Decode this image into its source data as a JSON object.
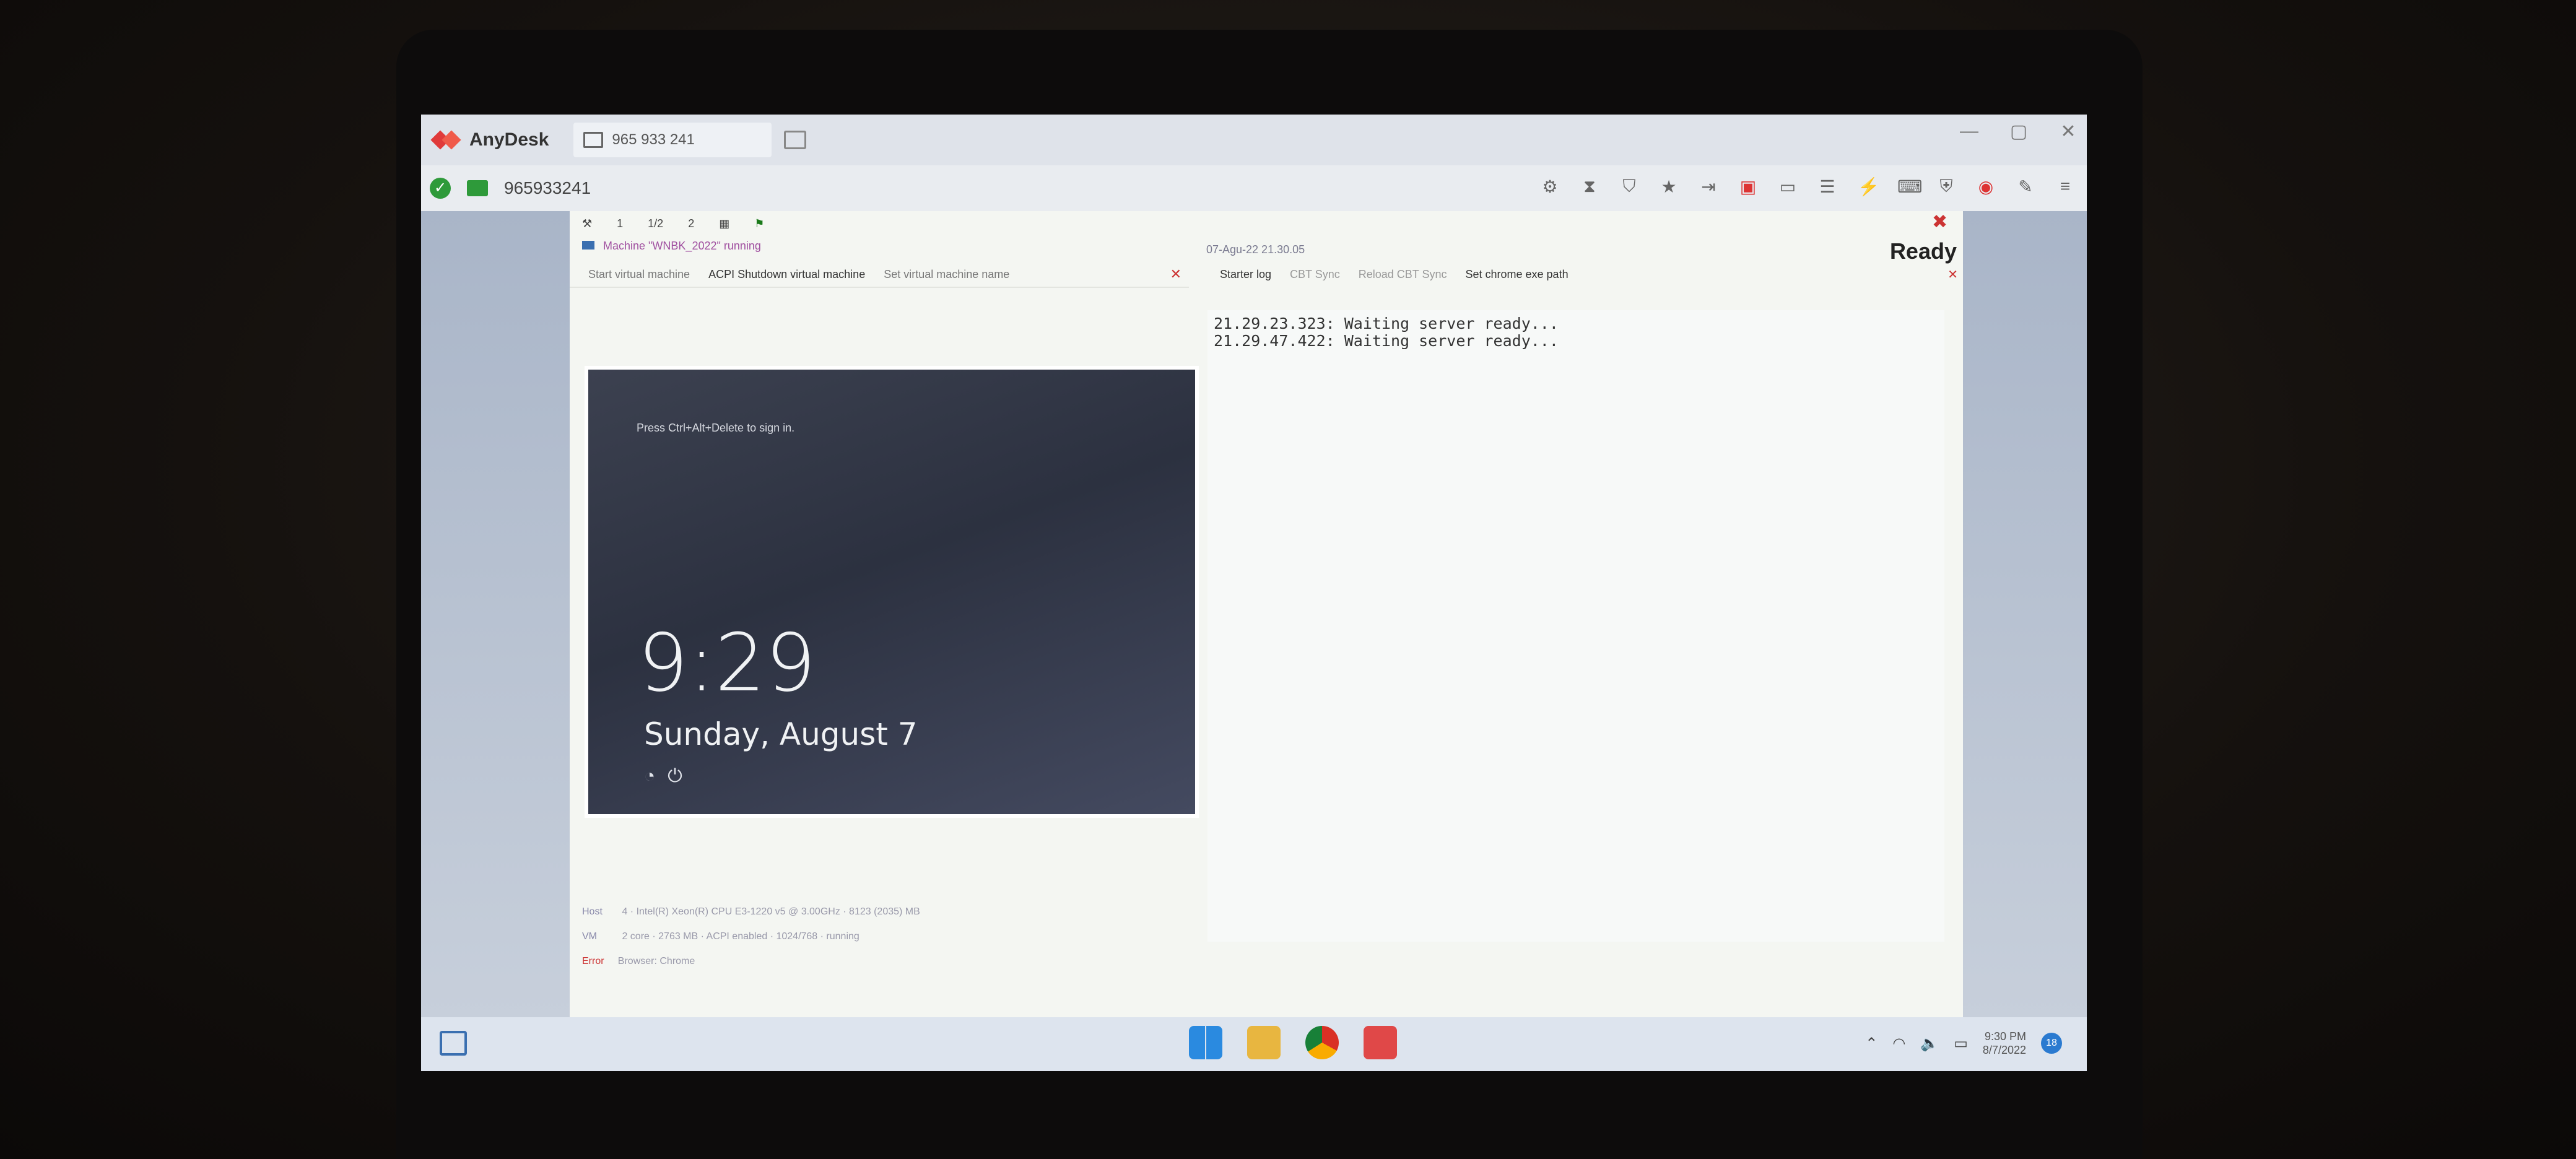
{
  "anydesk": {
    "app_name": "AnyDesk",
    "tab_label": "965 933 241",
    "address": "965933241",
    "window_controls": [
      "—",
      "▢",
      "✕"
    ]
  },
  "left_pane": {
    "toolbar": [
      "1",
      "1/2",
      "2"
    ],
    "status": "Machine \"WNBK_2022\" running",
    "actions": [
      "Start virtual machine",
      "ACPI Shutdown virtual machine",
      "Set virtual machine name"
    ],
    "vm_screen": {
      "prompt": "Press Ctrl+Alt+Delete to sign in.",
      "time": "9:29",
      "date": "Sunday, August 7"
    },
    "info": {
      "host_label": "Host",
      "host_value": "4 · Intel(R) Xeon(R) CPU E3-1220 v5 @ 3.00GHz · 8123 (2035) MB",
      "vm_label": "VM",
      "vm_value": "2 core · 2763 MB · ACPI enabled · 1024/768 · running",
      "error": "Error",
      "browser": "Browser: Chrome"
    }
  },
  "right_pane": {
    "date": "07-Agu-22 21.30.05",
    "status": "Ready",
    "tabs": [
      "Starter log",
      "CBT Sync",
      "Reload CBT Sync",
      "Set chrome exe path"
    ],
    "log": [
      "21.29.23.323: Waiting server ready...",
      "21.29.47.422: Waiting server ready..."
    ]
  },
  "taskbar": {
    "time": "9:30 PM",
    "date": "8/7/2022",
    "notifications": "18"
  }
}
